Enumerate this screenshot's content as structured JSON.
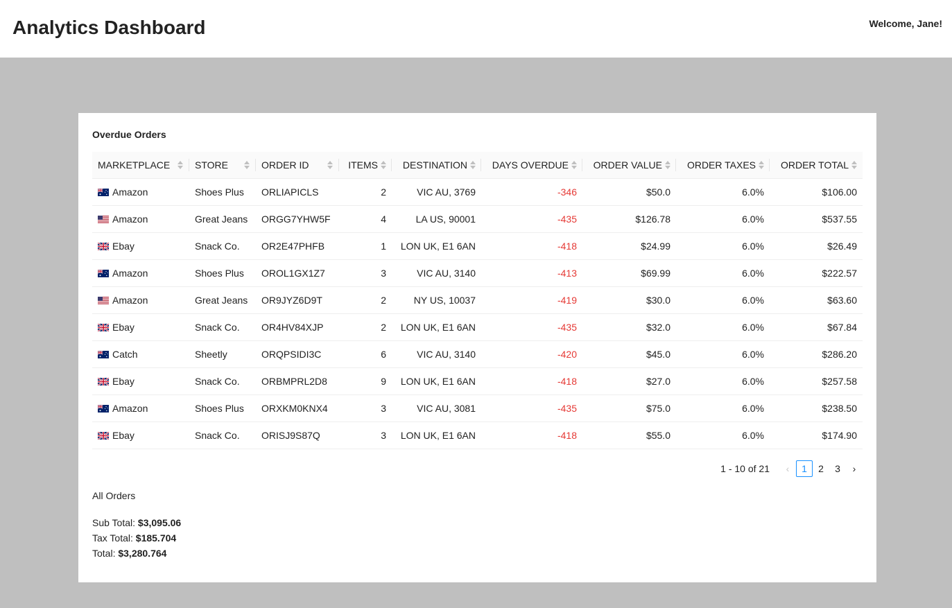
{
  "header": {
    "title": "Analytics Dashboard",
    "welcome": "Welcome, Jane!"
  },
  "overdue": {
    "title": "Overdue Orders",
    "columns": [
      "MARKETPLACE",
      "STORE",
      "ORDER ID",
      "ITEMS",
      "DESTINATION",
      "DAYS OVERDUE",
      "ORDER VALUE",
      "ORDER TAXES",
      "ORDER TOTAL"
    ],
    "rows": [
      {
        "flag": "au-flag-icon",
        "marketplace": "Amazon",
        "store": "Shoes Plus",
        "order_id": "ORLIAPICLS",
        "items": "2",
        "destination": "VIC AU, 3769",
        "days": "-346",
        "value": "$50.0",
        "taxes": "6.0%",
        "total": "$106.00"
      },
      {
        "flag": "us-flag-icon",
        "marketplace": "Amazon",
        "store": "Great Jeans",
        "order_id": "ORGG7YHW5F",
        "items": "4",
        "destination": "LA US, 90001",
        "days": "-435",
        "value": "$126.78",
        "taxes": "6.0%",
        "total": "$537.55"
      },
      {
        "flag": "uk-flag-icon",
        "marketplace": "Ebay",
        "store": "Snack Co.",
        "order_id": "OR2E47PHFB",
        "items": "1",
        "destination": "LON UK, E1 6AN",
        "days": "-418",
        "value": "$24.99",
        "taxes": "6.0%",
        "total": "$26.49"
      },
      {
        "flag": "au-flag-icon",
        "marketplace": "Amazon",
        "store": "Shoes Plus",
        "order_id": "OROL1GX1Z7",
        "items": "3",
        "destination": "VIC AU, 3140",
        "days": "-413",
        "value": "$69.99",
        "taxes": "6.0%",
        "total": "$222.57"
      },
      {
        "flag": "us-flag-icon",
        "marketplace": "Amazon",
        "store": "Great Jeans",
        "order_id": "OR9JYZ6D9T",
        "items": "2",
        "destination": "NY US, 10037",
        "days": "-419",
        "value": "$30.0",
        "taxes": "6.0%",
        "total": "$63.60"
      },
      {
        "flag": "uk-flag-icon",
        "marketplace": "Ebay",
        "store": "Snack Co.",
        "order_id": "OR4HV84XJP",
        "items": "2",
        "destination": "LON UK, E1 6AN",
        "days": "-435",
        "value": "$32.0",
        "taxes": "6.0%",
        "total": "$67.84"
      },
      {
        "flag": "au-flag-icon",
        "marketplace": "Catch",
        "store": "Sheetly",
        "order_id": "ORQPSIDI3C",
        "items": "6",
        "destination": "VIC AU, 3140",
        "days": "-420",
        "value": "$45.0",
        "taxes": "6.0%",
        "total": "$286.20"
      },
      {
        "flag": "uk-flag-icon",
        "marketplace": "Ebay",
        "store": "Snack Co.",
        "order_id": "ORBMPRL2D8",
        "items": "9",
        "destination": "LON UK, E1 6AN",
        "days": "-418",
        "value": "$27.0",
        "taxes": "6.0%",
        "total": "$257.58"
      },
      {
        "flag": "au-flag-icon",
        "marketplace": "Amazon",
        "store": "Shoes Plus",
        "order_id": "ORXKM0KNX4",
        "items": "3",
        "destination": "VIC AU, 3081",
        "days": "-435",
        "value": "$75.0",
        "taxes": "6.0%",
        "total": "$238.50"
      },
      {
        "flag": "uk-flag-icon",
        "marketplace": "Ebay",
        "store": "Snack Co.",
        "order_id": "ORISJ9S87Q",
        "items": "3",
        "destination": "LON UK, E1 6AN",
        "days": "-418",
        "value": "$55.0",
        "taxes": "6.0%",
        "total": "$174.90"
      }
    ]
  },
  "pagination": {
    "range": "1 - 10 of 21",
    "pages": [
      "1",
      "2",
      "3"
    ],
    "current": "1",
    "prev": "‹",
    "next": "›"
  },
  "summary": {
    "title": "All Orders",
    "sub_total_label": "Sub Total:",
    "sub_total": "$3,095.06",
    "tax_total_label": "Tax Total:",
    "tax_total": "$185.704",
    "total_label": "Total:",
    "total": "$3,280.764"
  },
  "colors": {
    "negative": "#e53935",
    "accent": "#1890ff",
    "background": "#bfbfbf"
  }
}
